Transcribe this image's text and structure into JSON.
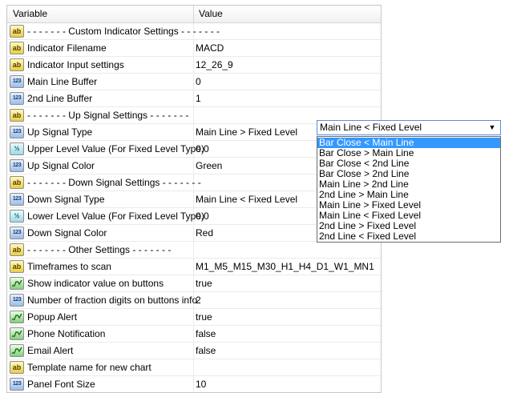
{
  "header": {
    "variable": "Variable",
    "value": "Value"
  },
  "rows": [
    {
      "icon": "ab",
      "name": "- - - - - - - Custom Indicator Settings - - - - - - -",
      "value": ""
    },
    {
      "icon": "ab",
      "name": "Indicator Filename",
      "value": "MACD"
    },
    {
      "icon": "ab",
      "name": "Indicator Input settings",
      "value": "12_26_9"
    },
    {
      "icon": "123",
      "name": "Main Line Buffer",
      "value": "0"
    },
    {
      "icon": "123",
      "name": "2nd Line Buffer",
      "value": "1"
    },
    {
      "icon": "ab",
      "name": "- - - - - - - Up Signal Settings - - - - - - -",
      "value": ""
    },
    {
      "icon": "123",
      "name": "Up Signal Type",
      "value": "Main Line > Fixed Level"
    },
    {
      "icon": "v2",
      "name": "Upper Level Value (For Fixed Level Type)",
      "value": "0.0"
    },
    {
      "icon": "123",
      "name": "Up Signal Color",
      "value": "Green"
    },
    {
      "icon": "ab",
      "name": "- - - - - - - Down Signal Settings - - - - - - -",
      "value": ""
    },
    {
      "icon": "123",
      "name": "Down Signal Type",
      "value": "Main Line < Fixed Level"
    },
    {
      "icon": "v2",
      "name": "Lower Level Value (For Fixed Level Type)",
      "value": "0.0"
    },
    {
      "icon": "123",
      "name": "Down Signal Color",
      "value": "Red"
    },
    {
      "icon": "ab",
      "name": "- - - - - - - Other Settings - - - - - - -",
      "value": ""
    },
    {
      "icon": "ab",
      "name": "Timeframes to scan",
      "value": "M1_M5_M15_M30_H1_H4_D1_W1_MN1"
    },
    {
      "icon": "bool",
      "name": "Show indicator value on buttons",
      "value": "true"
    },
    {
      "icon": "123",
      "name": "Number of fraction digits on buttons info",
      "value": "2"
    },
    {
      "icon": "bool",
      "name": "Popup Alert",
      "value": "true"
    },
    {
      "icon": "bool",
      "name": "Phone Notification",
      "value": "false"
    },
    {
      "icon": "bool",
      "name": "Email Alert",
      "value": "false"
    },
    {
      "icon": "ab",
      "name": "Template name for new chart",
      "value": ""
    },
    {
      "icon": "123",
      "name": "Panel Font Size",
      "value": "10"
    }
  ],
  "dropdown": {
    "current": "Main Line < Fixed Level",
    "options": [
      "Bar Close < Main Line",
      "Bar Close > Main Line",
      "Bar Close < 2nd Line",
      "Bar Close > 2nd Line",
      "Main Line > 2nd Line",
      "2nd Line > Main Line",
      "Main Line > Fixed Level",
      "Main Line < Fixed Level",
      "2nd Line > Fixed Level",
      "2nd Line < Fixed Level"
    ],
    "highlighted_index": 0
  },
  "colors": {
    "selection": "#3399ff",
    "focus_border": "#5b8ed9"
  }
}
